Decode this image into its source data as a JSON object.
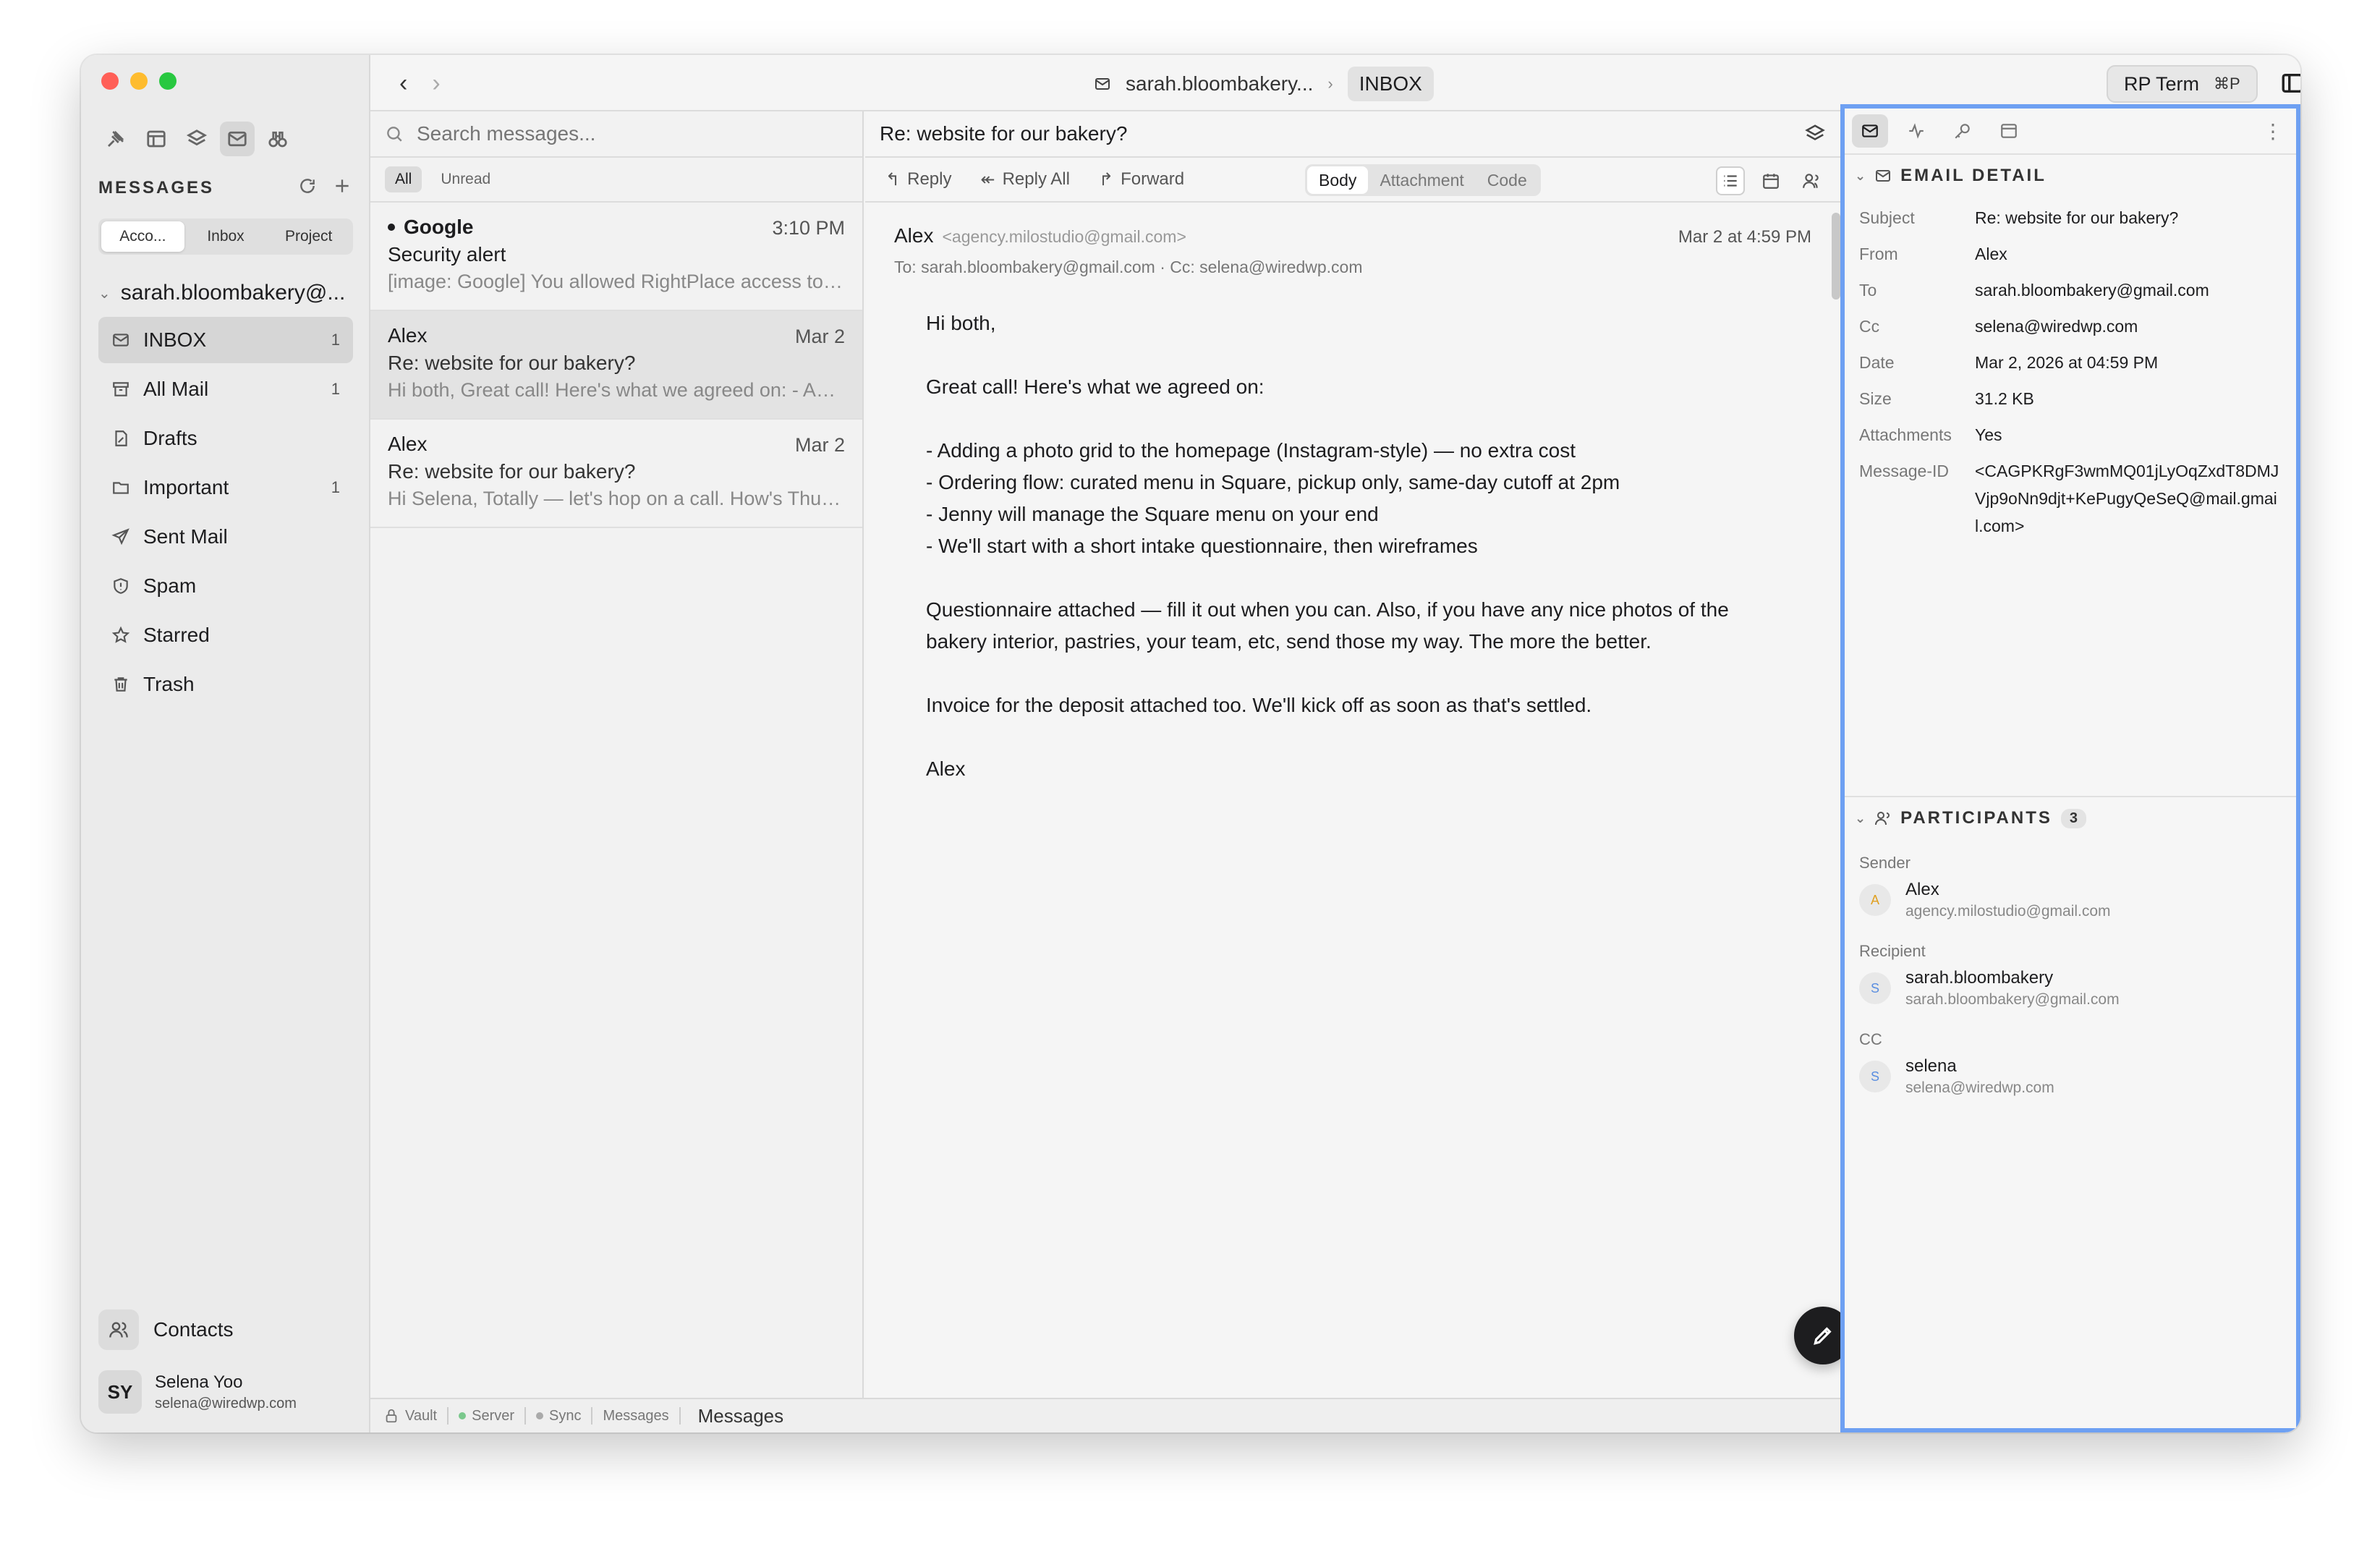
{
  "sidebar": {
    "section_title": "MESSAGES",
    "segments": [
      "Acco...",
      "Inbox",
      "Project"
    ],
    "account": "sarah.bloombakery@...",
    "folders": [
      {
        "label": "INBOX",
        "count": "1",
        "icon": "inbox-icon"
      },
      {
        "label": "All Mail",
        "count": "1",
        "icon": "archive-icon"
      },
      {
        "label": "Drafts",
        "count": "",
        "icon": "draft-icon"
      },
      {
        "label": "Important",
        "count": "1",
        "icon": "folder-icon"
      },
      {
        "label": "Sent Mail",
        "count": "",
        "icon": "send-icon"
      },
      {
        "label": "Spam",
        "count": "",
        "icon": "spam-icon"
      },
      {
        "label": "Starred",
        "count": "",
        "icon": "star-icon"
      },
      {
        "label": "Trash",
        "count": "",
        "icon": "trash-icon"
      }
    ],
    "contacts_label": "Contacts",
    "user": {
      "initials": "SY",
      "name": "Selena Yoo",
      "email": "selena@wiredwp.com"
    }
  },
  "topbar": {
    "account_crumb": "sarah.bloombakery...",
    "folder_crumb": "INBOX",
    "rp_term": "RP Term",
    "rp_shortcut": "⌘P"
  },
  "list": {
    "search_placeholder": "Search messages...",
    "filters": [
      "All",
      "Unread"
    ],
    "messages": [
      {
        "from": "Google",
        "date": "3:10 PM",
        "subject": "Security alert",
        "preview": "[image: Google] You allowed RightPlace access to your Google Account",
        "unread": true
      },
      {
        "from": "Alex",
        "date": "Mar 2",
        "subject": "Re: website for our bakery?",
        "preview": "Hi both, Great call! Here's what we agreed on: - Adding a photo grid",
        "unread": false
      },
      {
        "from": "Alex",
        "date": "Mar 2",
        "subject": "Re: website for our bakery?",
        "preview": "Hi Selena, Totally — let's hop on a call. How's Thursday?",
        "unread": false
      }
    ]
  },
  "reader": {
    "title": "Re: website for our bakery?",
    "actions": [
      "Reply",
      "Reply All",
      "Forward"
    ],
    "views": [
      "Body",
      "Attachment",
      "Code"
    ],
    "from_name": "Alex",
    "from_addr": "<agency.milostudio@gmail.com>",
    "to_line": "To: sarah.bloombakery@gmail.com · Cc: selena@wiredwp.com",
    "date": "Mar 2 at 4:59 PM",
    "body": {
      "greeting": "Hi both,",
      "intro": "Great call! Here's what we agreed on:",
      "bullets": [
        "- Adding a photo grid to the homepage (Instagram-style) — no extra cost",
        "- Ordering flow: curated menu in Square, pickup only, same-day cutoff at 2pm",
        "- Jenny will manage the Square menu on your end",
        "- We'll start with a short intake questionnaire, then wireframes"
      ],
      "para1": "Questionnaire attached — fill it out when you can. Also, if you have any nice photos of the bakery interior, pastries, your team, etc, send those my way. The more the better.",
      "para2": "Invoice for the deposit attached too. We'll kick off as soon as that's settled.",
      "signoff": "Alex"
    }
  },
  "status": {
    "vault": "Vault",
    "server": "Server",
    "sync": "Sync",
    "messages_small": "Messages",
    "messages_big": "Messages"
  },
  "detail": {
    "section_title": "EMAIL DETAIL",
    "fields": [
      {
        "k": "Subject",
        "v": "Re: website for our bakery?"
      },
      {
        "k": "From",
        "v": "Alex"
      },
      {
        "k": "To",
        "v": "sarah.bloombakery@gmail.com"
      },
      {
        "k": "Cc",
        "v": "selena@wiredwp.com"
      },
      {
        "k": "Date",
        "v": "Mar 2, 2026 at 04:59 PM"
      },
      {
        "k": "Size",
        "v": "31.2 KB"
      },
      {
        "k": "Attachments",
        "v": "Yes"
      },
      {
        "k": "Message-ID",
        "v": "<CAGPKRgF3wmMQ01jLyOqZxdT8DMJVjp9oNn9djt+KePugyQeSeQ@mail.gmail.com>"
      }
    ],
    "participants_title": "PARTICIPANTS",
    "participants_count": "3",
    "groups": [
      {
        "label": "Sender",
        "initial": "A",
        "name": "Alex",
        "email": "agency.milostudio@gmail.com",
        "color": "#e0a020"
      },
      {
        "label": "Recipient",
        "initial": "S",
        "name": "sarah.bloombakery",
        "email": "sarah.bloombakery@gmail.com",
        "color": "#5a8ee0"
      },
      {
        "label": "CC",
        "initial": "S",
        "name": "selena",
        "email": "selena@wiredwp.com",
        "color": "#5a8ee0"
      }
    ]
  },
  "colors": {
    "accent_outline": "#6ea0f2",
    "fab": "#1d1d1f"
  }
}
